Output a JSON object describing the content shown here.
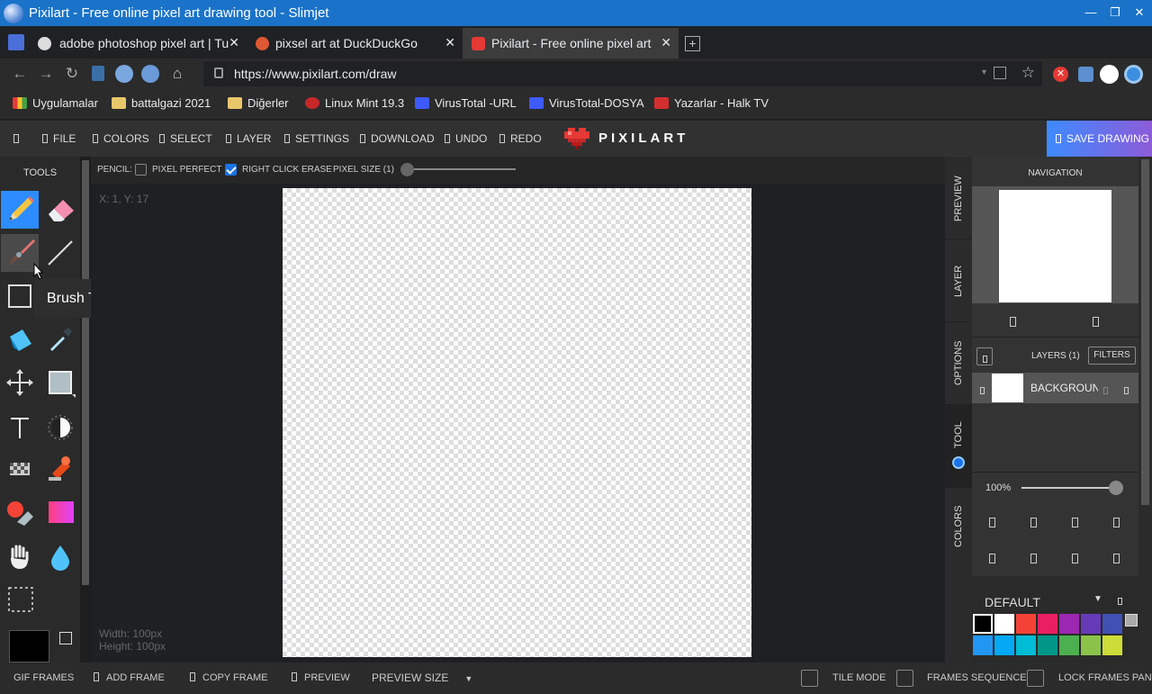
{
  "window": {
    "title": "Pixilart - Free online pixel art drawing tool - Slimjet"
  },
  "tabs": [
    {
      "label": "adobe photoshop pixel art | Tu"
    },
    {
      "label": "pixsel art at DuckDuckGo"
    },
    {
      "label": "Pixilart - Free online pixel art dr"
    }
  ],
  "address": {
    "url": "https://www.pixilart.com/draw"
  },
  "bookmarks": [
    {
      "label": "Uygulamalar"
    },
    {
      "label": "battalgazi 2021"
    },
    {
      "label": "Diğerler"
    },
    {
      "label": "Linux Mint 19.3"
    },
    {
      "label": "VirusTotal -URL"
    },
    {
      "label": "VirusTotal-DOSYA"
    },
    {
      "label": "Yazarlar - Halk TV"
    }
  ],
  "menu": {
    "items": [
      "FILE",
      "COLORS",
      "SELECT",
      "LAYER",
      "SETTINGS",
      "DOWNLOAD",
      "UNDO",
      "REDO"
    ],
    "brand": "PIXILART",
    "save": "SAVE DRAWING"
  },
  "tools": {
    "header": "TOOLS",
    "tooltip": "Brush Tool (R)",
    "icons": [
      "pencil-icon",
      "eraser-icon",
      "brush-icon",
      "line-icon",
      "rectangle-icon",
      "fill-bucket-icon",
      "eyedropper-icon",
      "move-icon",
      "shape-icon",
      "text-icon",
      "dither-icon",
      "dither-pattern-icon",
      "stamp-icon",
      "color-replace-icon",
      "gradient-icon",
      "hand-icon",
      "droplet-icon",
      "select-icon"
    ]
  },
  "options": {
    "tool_label": "PENCIL:",
    "pixel_perfect": "PIXEL PERFECT",
    "right_click_erase": "RIGHT CLICK ERASE",
    "pixel_size": "PIXEL SIZE (1)"
  },
  "canvas": {
    "coords": "X: 1, Y: 17",
    "width": "Width: 100px",
    "height": "Height: 100px"
  },
  "sidetabs": [
    "PREVIEW",
    "LAYER",
    "OPTIONS",
    "TOOL",
    "COLORS"
  ],
  "panel": {
    "navigation": "NAVIGATION",
    "layers_title": "LAYERS (1)",
    "filters": "FILTERS",
    "layer_name": "BACKGROUND",
    "zoom": "100%",
    "palette_name": "DEFAULT",
    "palette_colors": [
      "#000000",
      "#ffffff",
      "#f44336",
      "#e91e63",
      "#9c27b0",
      "#673ab7",
      "#3f51b5",
      "#2196f3",
      "#03a9f4",
      "#00bcd4",
      "#009688",
      "#4caf50",
      "#8bc34a",
      "#cddc39"
    ]
  },
  "bottom": {
    "gif_frames": "GIF FRAMES",
    "add_frame": "ADD FRAME",
    "copy_frame": "COPY FRAME",
    "preview": "PREVIEW",
    "preview_size": "PREVIEW SIZE",
    "tile_mode": "TILE MODE",
    "frames_sequence": "FRAMES SEQUENCE",
    "lock_frames": "LOCK FRAMES PANEL"
  }
}
